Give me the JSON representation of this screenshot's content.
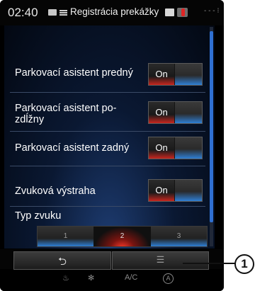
{
  "status_bar": {
    "time": "02:40",
    "title": "Registrácia prekážky",
    "icons": [
      "media-icon",
      "list-icon",
      "phone-icon",
      "battery-icon",
      "signal-icon"
    ]
  },
  "settings": [
    {
      "label": "Parkovací asistent predný",
      "state": "On"
    },
    {
      "label": "Parkovací asistent po-\nzdĺžny",
      "state": "On"
    },
    {
      "label": "Parkovací asistent zadný",
      "state": "On"
    },
    {
      "label": "Zvuková výstraha",
      "state": "On"
    }
  ],
  "sound_type": {
    "label": "Typ zvuku",
    "options": [
      "1",
      "2",
      "3"
    ],
    "selected": "2"
  },
  "bottom_bar": {
    "back_icon": "⮌",
    "menu_icon": "☰"
  },
  "climate_bar": {
    "fan_label": "A/C",
    "auto_label": "A"
  },
  "callout": {
    "number": "1"
  },
  "colors": {
    "active": "#c8261f",
    "accent": "#2f7fd4",
    "background": "#000000"
  }
}
